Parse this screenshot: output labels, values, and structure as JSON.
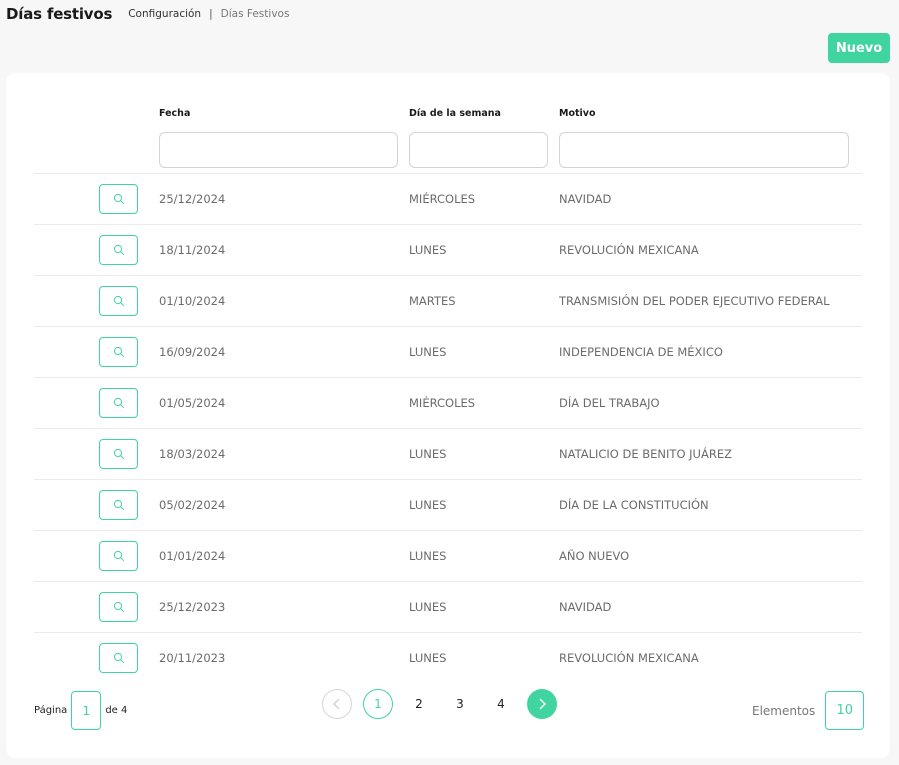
{
  "header": {
    "title": "Días festivos",
    "breadcrumb": {
      "parent": "Configuración",
      "separator": "|",
      "current": "Días Festivos"
    }
  },
  "toolbar": {
    "new_label": "Nuevo"
  },
  "table": {
    "columns": {
      "fecha": "Fecha",
      "dia": "Día de la semana",
      "motivo": "Motivo"
    },
    "filters": {
      "fecha": "",
      "dia": "",
      "motivo": ""
    },
    "rows": [
      {
        "fecha": "25/12/2024",
        "dia": "MIÉRCOLES",
        "motivo": "NAVIDAD"
      },
      {
        "fecha": "18/11/2024",
        "dia": "LUNES",
        "motivo": "REVOLUCIÓN MEXICANA"
      },
      {
        "fecha": "01/10/2024",
        "dia": "MARTES",
        "motivo": "TRANSMISIÓN DEL PODER EJECUTIVO FEDERAL"
      },
      {
        "fecha": "16/09/2024",
        "dia": "LUNES",
        "motivo": "INDEPENDENCIA DE MÉXICO"
      },
      {
        "fecha": "01/05/2024",
        "dia": "MIÉRCOLES",
        "motivo": "DÍA DEL TRABAJO"
      },
      {
        "fecha": "18/03/2024",
        "dia": "LUNES",
        "motivo": "NATALICIO DE BENITO JUÁREZ"
      },
      {
        "fecha": "05/02/2024",
        "dia": "LUNES",
        "motivo": "DÍA DE LA CONSTITUCIÓN"
      },
      {
        "fecha": "01/01/2024",
        "dia": "LUNES",
        "motivo": "AÑO NUEVO"
      },
      {
        "fecha": "25/12/2023",
        "dia": "LUNES",
        "motivo": "NAVIDAD"
      },
      {
        "fecha": "20/11/2023",
        "dia": "LUNES",
        "motivo": "REVOLUCIÓN MEXICANA"
      }
    ],
    "row_action_icon": "search-icon"
  },
  "pagination": {
    "page_label": "Página",
    "current_page": "1",
    "of_label": "de 4",
    "pages": [
      "1",
      "2",
      "3",
      "4"
    ],
    "active_page": "1",
    "elements_label": "Elementos",
    "elements_value": "10"
  },
  "colors": {
    "accent": "#3fd4a0",
    "background": "#f7f7f7",
    "card": "#ffffff"
  }
}
